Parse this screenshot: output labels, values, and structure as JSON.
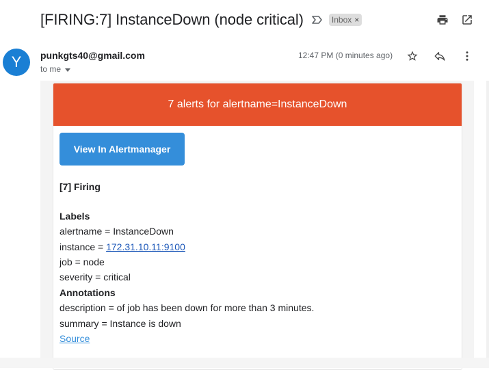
{
  "subject": {
    "text": "[FIRING:7] InstanceDown (node critical)",
    "label": "Inbox",
    "label_remove": "×"
  },
  "icons": {
    "importance": "importance-marker-icon",
    "print": "print-icon",
    "popout": "open-in-new-window-icon",
    "star": "star-icon",
    "reply": "reply-icon",
    "more": "more-vertical-icon",
    "dropdown": "chevron-down-icon"
  },
  "message": {
    "avatar_letter": "Y",
    "sender": "punkgts40@gmail.com",
    "to": "to me",
    "time": "12:47 PM (0 minutes ago)"
  },
  "alert": {
    "header": "7 alerts for alertname=InstanceDown",
    "button": "View In Alertmanager",
    "firing": "[7] Firing",
    "labels_heading": "Labels",
    "alertname": "alertname = InstanceDown",
    "instance_prefix": "instance = ",
    "instance_link": "172.31.10.11:9100",
    "job": "job = node",
    "severity": "severity = critical",
    "annotations_heading": "Annotations",
    "description": "description = of job has been down for more than 3 minutes.",
    "summary": "summary = Instance is down",
    "source": "Source"
  },
  "colors": {
    "header_bg": "#e6522c",
    "button_bg": "#348eda",
    "avatar_bg": "#1a7fd4",
    "link": "#1a56b8"
  }
}
